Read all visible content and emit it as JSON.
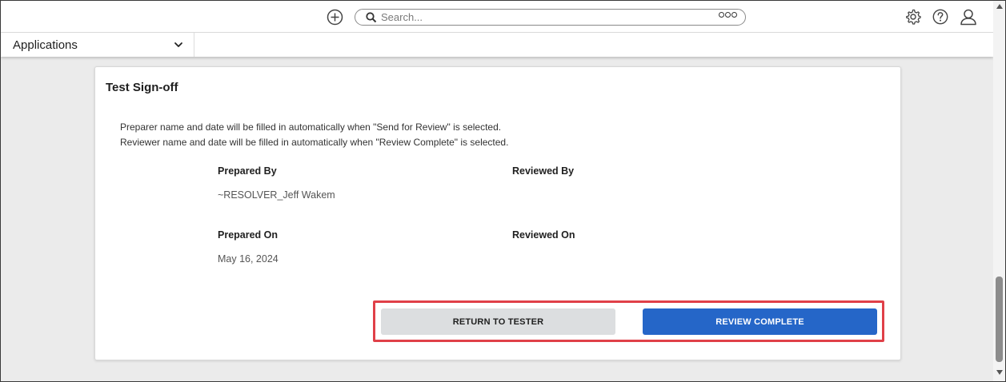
{
  "header": {
    "search": {
      "placeholder": "Search..."
    }
  },
  "appbar": {
    "selected_app": "Applications"
  },
  "card": {
    "title": "Test Sign-off",
    "notes": [
      "Preparer name and date will be filled in automatically when \"Send for Review\" is selected.",
      "Reviewer name and date will be filled in automatically when \"Review Complete\" is selected."
    ],
    "fields": {
      "prepared_by": {
        "label": "Prepared By",
        "value": "~RESOLVER_Jeff Wakem"
      },
      "reviewed_by": {
        "label": "Reviewed By",
        "value": ""
      },
      "prepared_on": {
        "label": "Prepared On",
        "value": "May 16, 2024"
      },
      "reviewed_on": {
        "label": "Reviewed On",
        "value": ""
      }
    },
    "buttons": {
      "return_label": "RETURN TO TESTER",
      "complete_label": "REVIEW COMPLETE"
    }
  },
  "colors": {
    "primary": "#2566c8",
    "secondary_button": "#dcdee0",
    "highlight": "#e04048",
    "background": "#ebebeb"
  },
  "icons": [
    "add-icon",
    "search-icon",
    "more-icon",
    "gear-icon",
    "help-icon",
    "user-icon",
    "chevron-down-icon"
  ]
}
